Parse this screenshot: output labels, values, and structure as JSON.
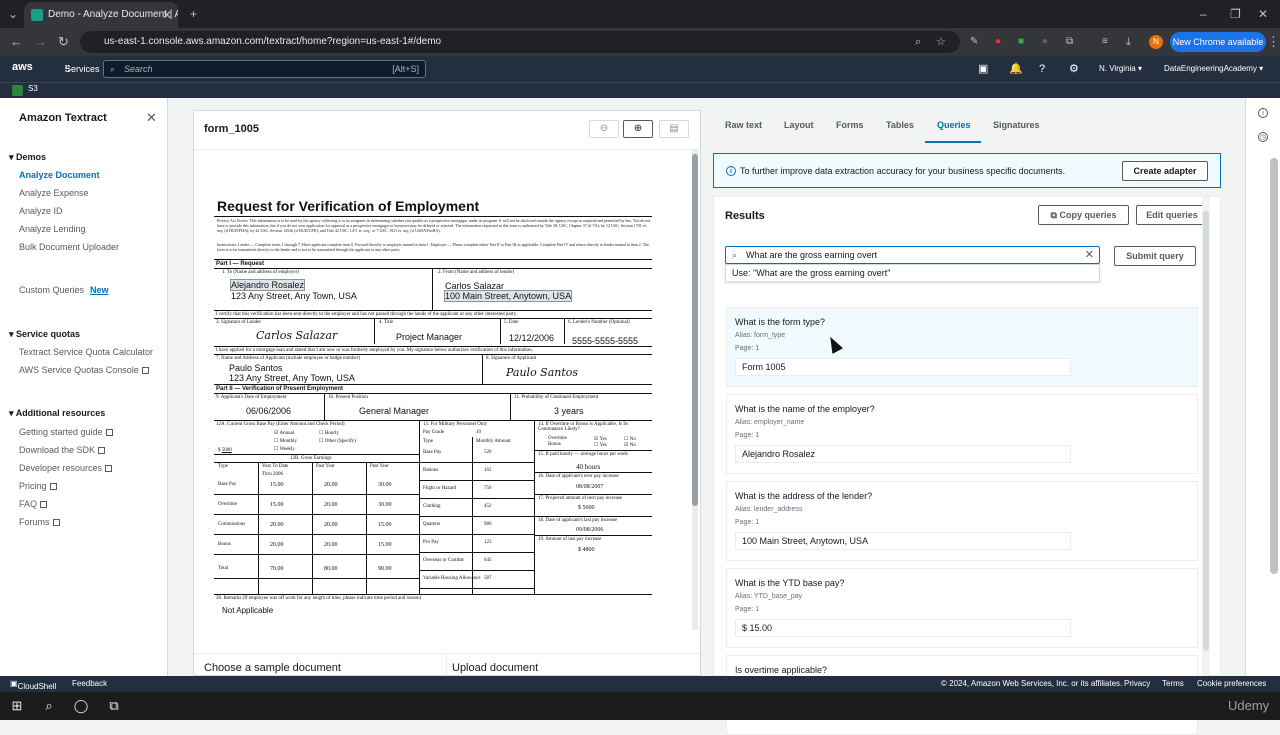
{
  "browser": {
    "tab_title": "Demo - Analyze Document | Am",
    "url": "us-east-1.console.aws.amazon.com/textract/home?region=us-east-1#/demo",
    "new_chrome": "New Chrome available",
    "profile_initial": "N"
  },
  "aws": {
    "logo": "aws",
    "services": "Services",
    "search_placeholder": "Search",
    "search_shortcut": "[Alt+S]",
    "region": "N. Virginia ▾",
    "account": "DataEngineeringAcademy ▾",
    "favorite": "S3"
  },
  "sidenav": {
    "title": "Amazon Textract",
    "demos_header": "Demos",
    "demos": [
      "Analyze Document",
      "Analyze Expense",
      "Analyze ID",
      "Analyze Lending",
      "Bulk Document Uploader"
    ],
    "custom_queries": "Custom Queries",
    "new_badge": "New",
    "quotas_header": "Service quotas",
    "quotas": [
      "Textract Service Quota Calculator",
      "AWS Service Quotas Console"
    ],
    "resources_header": "Additional resources",
    "resources": [
      "Getting started guide",
      "Download the SDK",
      "Developer resources",
      "Pricing",
      "FAQ",
      "Forums"
    ]
  },
  "viewer": {
    "title": "form_1005",
    "choose_sample": "Choose a sample document",
    "upload": "Upload document"
  },
  "form": {
    "title": "Request for Verification of Employment",
    "privacy": "Privacy Act Notice: This information is to be used by the agency collecting it or its assignees in determining whether you qualify as a prospective mortgagor under its program. It will not be disclosed outside the agency except as required and permitted by law. You do not have to provide this information, but if you do not your application for approval as a prospective mortgagor or borrower may be delayed or rejected. The information requested in this form is authorized by Title 38, USC, Chapter 37 (if VA); by 12 USC, Section 1701 et. seq. (if HUD/FHA); by 42 USC, Section 1452b (if HUD/CPD); and Title 42 USC, 1471 et. seq., or 7 USC, 1921 et. seq. (if USDA/FmHA).",
    "instructions": "Instructions: Lender — Complete items 1 through 7. Have applicant complete item 8. Forward directly to employer named in item 1. Employer — Please complete either Part II or Part III as applicable. Complete Part IV and return directly to lender named in item 2. The form is to be transmitted directly to the lender and is not to be transmitted through the applicant or any other party.",
    "part1": "Part I — Request",
    "l1": "1. To (Name and address of employer)",
    "employer_name": "Alejandro Rosalez",
    "employer_addr": "123 Any Street, Any Town, USA",
    "l2": "2. From (Name and address of lender)",
    "lender_name": "Carlos Salazar",
    "lender_addr": "100 Main Street, Anytown, USA",
    "certify": "I certify that this verification has been sent directly to the employer and has not passed through the hands of the applicant or any other interested party.",
    "l3": "3. Signature of Lender",
    "sig_lender": "Carlos Salazar",
    "l4": "4. Title",
    "title_val": "Project Manager",
    "l5": "5. Date",
    "date_val": "12/12/2006",
    "l6": "6. Lender's Number (Optional)",
    "lender_num": "5555-5555-5555",
    "applied": "I have applied for a mortgage loan and stated that I am now or was formerly employed by you. My signature below authorizes verification of this information.",
    "l7": "7. Name and Address of Applicant (include employee or badge number)",
    "applicant_name": "Paulo Santos",
    "applicant_addr": "123 Any Street, Any Town, USA",
    "l8": "8. Signature of Applicant",
    "sig_applicant": "Paulo Santos",
    "part2": "Part II — Verification of Present Employment",
    "l9": "9. Applicant's Date of Employment",
    "doe": "06/06/2006",
    "l10": "10. Present Position",
    "position": "General Manager",
    "l11": "11. Probability of Continued Employment",
    "prob": "3 years",
    "l12a": "12A. Current Gross Base Pay (Enter Amount and Check Period)",
    "annual": "Annual",
    "hourly": "Hourly",
    "monthly": "Monthly",
    "other": "Other (Specify)",
    "weekly": "Weekly",
    "base_amount": "5600",
    "l12b": "12B. Gross Earnings",
    "col_type": "Type",
    "col_ytd": "Year To Date",
    "col_past1": "Past Year",
    "col_past2": "Past Year",
    "thru": "Thru",
    "thru_year": "2006",
    "rows": [
      {
        "type": "Base Pay",
        "ytd": "15.00",
        "p1": "20.00",
        "p2": "30.00"
      },
      {
        "type": "Overtime",
        "ytd": "15.00",
        "p1": "20.00",
        "p2": "30.00"
      },
      {
        "type": "Commissions",
        "ytd": "20.00",
        "p1": "20.00",
        "p2": "15.00"
      },
      {
        "type": "Bonus",
        "ytd": "20.00",
        "p1": "20.00",
        "p2": "15.00"
      },
      {
        "type": "Total",
        "ytd": "70.00",
        "p1": "80.00",
        "p2": "90.00"
      }
    ],
    "l13": "13. For Military Personnel Only",
    "pay_grade_label": "Pay Grade",
    "pay_grade": "10",
    "mil_type": "Type",
    "mil_amount": "Monthly Amount",
    "mil_rows": [
      {
        "type": "Base Pay",
        "amt": "520"
      },
      {
        "type": "Rations",
        "amt": "162"
      },
      {
        "type": "Flight or Hazard",
        "amt": "756"
      },
      {
        "type": "Clothing",
        "amt": "452"
      },
      {
        "type": "Quarters",
        "amt": "986"
      },
      {
        "type": "Pro Pay",
        "amt": "123"
      },
      {
        "type": "Overseas or Combat",
        "amt": "645"
      },
      {
        "type": "Variable Housing Allowance",
        "amt": "587"
      }
    ],
    "l14": "14. If Overtime or Bonus is Applicable, Is Its Continuance Likely?",
    "overtime": "Overtime",
    "bonus": "Bonus",
    "yes": "Yes",
    "no": "No",
    "l15": "15. If paid hourly — average hours per week",
    "hours": "40 hours",
    "l16": "16. Date of applicant's next pay increase",
    "next_inc": "08/08/2007",
    "l17": "17. Projected amount of next pay increase",
    "proj": "$ 5600",
    "l18": "18. Date of applicant's last pay increase",
    "last_inc": "09/08/2006",
    "l19": "19. Amount of last pay increase",
    "last_amt": "$ 4800",
    "l20": "20. Remarks (If employee was off work for any length of time, please indicate time period and reason)",
    "remarks": "Not Applicable"
  },
  "right": {
    "tabs": [
      "Raw text",
      "Layout",
      "Forms",
      "Tables",
      "Queries",
      "Signatures"
    ],
    "active_tab": "Queries",
    "info": "To further improve data extraction accuracy for your business specific documents.",
    "create_adapter": "Create adapter",
    "results_title": "Results",
    "copy_queries": "Copy queries",
    "edit_queries": "Edit queries",
    "query_value": "What are the gross earning overt",
    "submit": "Submit query",
    "suggestion": "Use: \"What are the gross earning overt\"",
    "cards": [
      {
        "q": "What is the form type?",
        "alias": "Alias: form_type",
        "page": "Page: 1",
        "answer": "Form 1005"
      },
      {
        "q": "What is the name of the employer?",
        "alias": "Alias: employer_name",
        "page": "Page: 1",
        "answer": "Alejandro Rosalez"
      },
      {
        "q": "What is the address of the lender?",
        "alias": "Alias: lender_address",
        "page": "Page: 1",
        "answer": "100 Main Street, Anytown, USA"
      },
      {
        "q": "What is the YTD base pay?",
        "alias": "Alias: YTD_base_pay",
        "page": "Page: 1",
        "answer": "$ 15.00"
      },
      {
        "q": "Is overtime applicable?",
        "alias": "",
        "page": "",
        "answer": ""
      }
    ]
  },
  "footer": {
    "cloudshell": "CloudShell",
    "feedback": "Feedback",
    "copyright": "© 2024, Amazon Web Services, Inc. or its affiliates.",
    "privacy": "Privacy",
    "terms": "Terms",
    "cookies": "Cookie preferences"
  },
  "watermark": "Udemy",
  "colors": {
    "aws_header": "#232f3e",
    "link": "#0073bb",
    "chrome_blue": "#1a73e8"
  }
}
